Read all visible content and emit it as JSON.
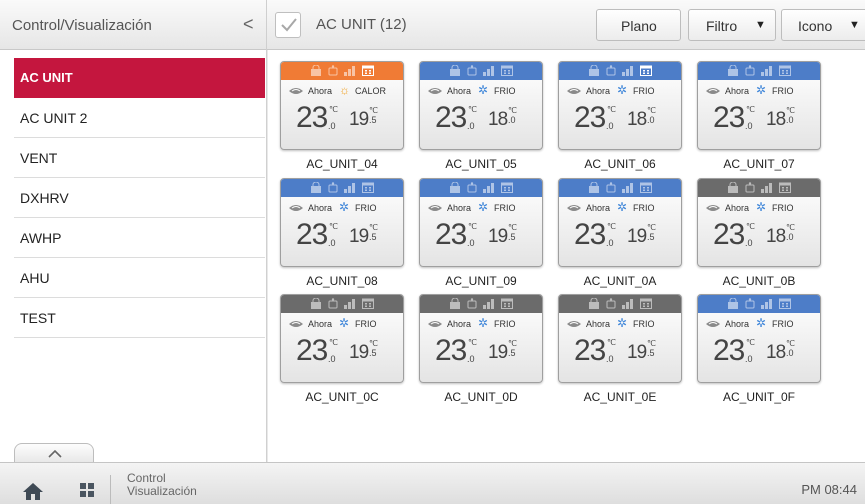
{
  "header": {
    "section_title": "Control/Visualización",
    "back_glyph": "<",
    "main_title": "AC UNIT (12)",
    "plano_label": "Plano",
    "filtro_label": "Filtro",
    "icono_label": "Icono",
    "dropdown_glyph": "▼"
  },
  "sidebar": {
    "items": [
      {
        "label": "AC UNIT",
        "active": true
      },
      {
        "label": "AC UNIT 2",
        "active": false
      },
      {
        "label": "VENT",
        "active": false
      },
      {
        "label": "DXHRV",
        "active": false
      },
      {
        "label": "AWHP",
        "active": false
      },
      {
        "label": "AHU",
        "active": false
      },
      {
        "label": "TEST",
        "active": false
      }
    ],
    "collapse_icon": "chevron-up-icon"
  },
  "units": [
    {
      "name": "AC_UNIT_04",
      "status_color": "#f07b35",
      "schedule_on": true,
      "now_label": "Ahora",
      "mode_icon": "sun-icon",
      "mode": "CALOR",
      "current_temp": "23",
      "current_dec": ".0",
      "set_temp": "19",
      "set_dec": ".5",
      "unit_symbol": "℃"
    },
    {
      "name": "AC_UNIT_05",
      "status_color": "#4d7dc8",
      "schedule_on": false,
      "now_label": "Ahora",
      "mode_icon": "snowflake-icon",
      "mode": "FRIO",
      "current_temp": "23",
      "current_dec": ".0",
      "set_temp": "18",
      "set_dec": ".0",
      "unit_symbol": "℃"
    },
    {
      "name": "AC_UNIT_06",
      "status_color": "#4d7dc8",
      "schedule_on": true,
      "now_label": "Ahora",
      "mode_icon": "snowflake-icon",
      "mode": "FRIO",
      "current_temp": "23",
      "current_dec": ".0",
      "set_temp": "18",
      "set_dec": ".0",
      "unit_symbol": "℃"
    },
    {
      "name": "AC_UNIT_07",
      "status_color": "#4d7dc8",
      "schedule_on": false,
      "now_label": "Ahora",
      "mode_icon": "snowflake-icon",
      "mode": "FRIO",
      "current_temp": "23",
      "current_dec": ".0",
      "set_temp": "18",
      "set_dec": ".0",
      "unit_symbol": "℃"
    },
    {
      "name": "AC_UNIT_08",
      "status_color": "#4d7dc8",
      "schedule_on": false,
      "now_label": "Ahora",
      "mode_icon": "snowflake-icon",
      "mode": "FRIO",
      "current_temp": "23",
      "current_dec": ".0",
      "set_temp": "19",
      "set_dec": ".5",
      "unit_symbol": "℃"
    },
    {
      "name": "AC_UNIT_09",
      "status_color": "#4d7dc8",
      "schedule_on": false,
      "now_label": "Ahora",
      "mode_icon": "snowflake-icon",
      "mode": "FRIO",
      "current_temp": "23",
      "current_dec": ".0",
      "set_temp": "19",
      "set_dec": ".5",
      "unit_symbol": "℃"
    },
    {
      "name": "AC_UNIT_0A",
      "status_color": "#4d7dc8",
      "schedule_on": false,
      "now_label": "Ahora",
      "mode_icon": "snowflake-icon",
      "mode": "FRIO",
      "current_temp": "23",
      "current_dec": ".0",
      "set_temp": "19",
      "set_dec": ".5",
      "unit_symbol": "℃"
    },
    {
      "name": "AC_UNIT_0B",
      "status_color": "#6b6b6b",
      "schedule_on": false,
      "now_label": "Ahora",
      "mode_icon": "snowflake-icon",
      "mode": "FRIO",
      "current_temp": "23",
      "current_dec": ".0",
      "set_temp": "18",
      "set_dec": ".0",
      "unit_symbol": "℃"
    },
    {
      "name": "AC_UNIT_0C",
      "status_color": "#6b6b6b",
      "schedule_on": false,
      "now_label": "Ahora",
      "mode_icon": "snowflake-icon",
      "mode": "FRIO",
      "current_temp": "23",
      "current_dec": ".0",
      "set_temp": "19",
      "set_dec": ".5",
      "unit_symbol": "℃"
    },
    {
      "name": "AC_UNIT_0D",
      "status_color": "#6b6b6b",
      "schedule_on": false,
      "now_label": "Ahora",
      "mode_icon": "snowflake-icon",
      "mode": "FRIO",
      "current_temp": "23",
      "current_dec": ".0",
      "set_temp": "19",
      "set_dec": ".5",
      "unit_symbol": "℃"
    },
    {
      "name": "AC_UNIT_0E",
      "status_color": "#6b6b6b",
      "schedule_on": false,
      "now_label": "Ahora",
      "mode_icon": "snowflake-icon",
      "mode": "FRIO",
      "current_temp": "23",
      "current_dec": ".0",
      "set_temp": "19",
      "set_dec": ".5",
      "unit_symbol": "℃"
    },
    {
      "name": "AC_UNIT_0F",
      "status_color": "#4d7dc8",
      "schedule_on": false,
      "now_label": "Ahora",
      "mode_icon": "snowflake-icon",
      "mode": "FRIO",
      "current_temp": "23",
      "current_dec": ".0",
      "set_temp": "18",
      "set_dec": ".0",
      "unit_symbol": "℃"
    }
  ],
  "bottom": {
    "nav_line1": "Control",
    "nav_line2": "Visualización",
    "clock": "PM 08:44",
    "home_icon": "home-icon",
    "grid_icon": "grid-icon"
  },
  "colors": {
    "accent": "#c4163e",
    "status_heating": "#f07b35",
    "status_running": "#4d7dc8",
    "status_off": "#6b6b6b"
  }
}
